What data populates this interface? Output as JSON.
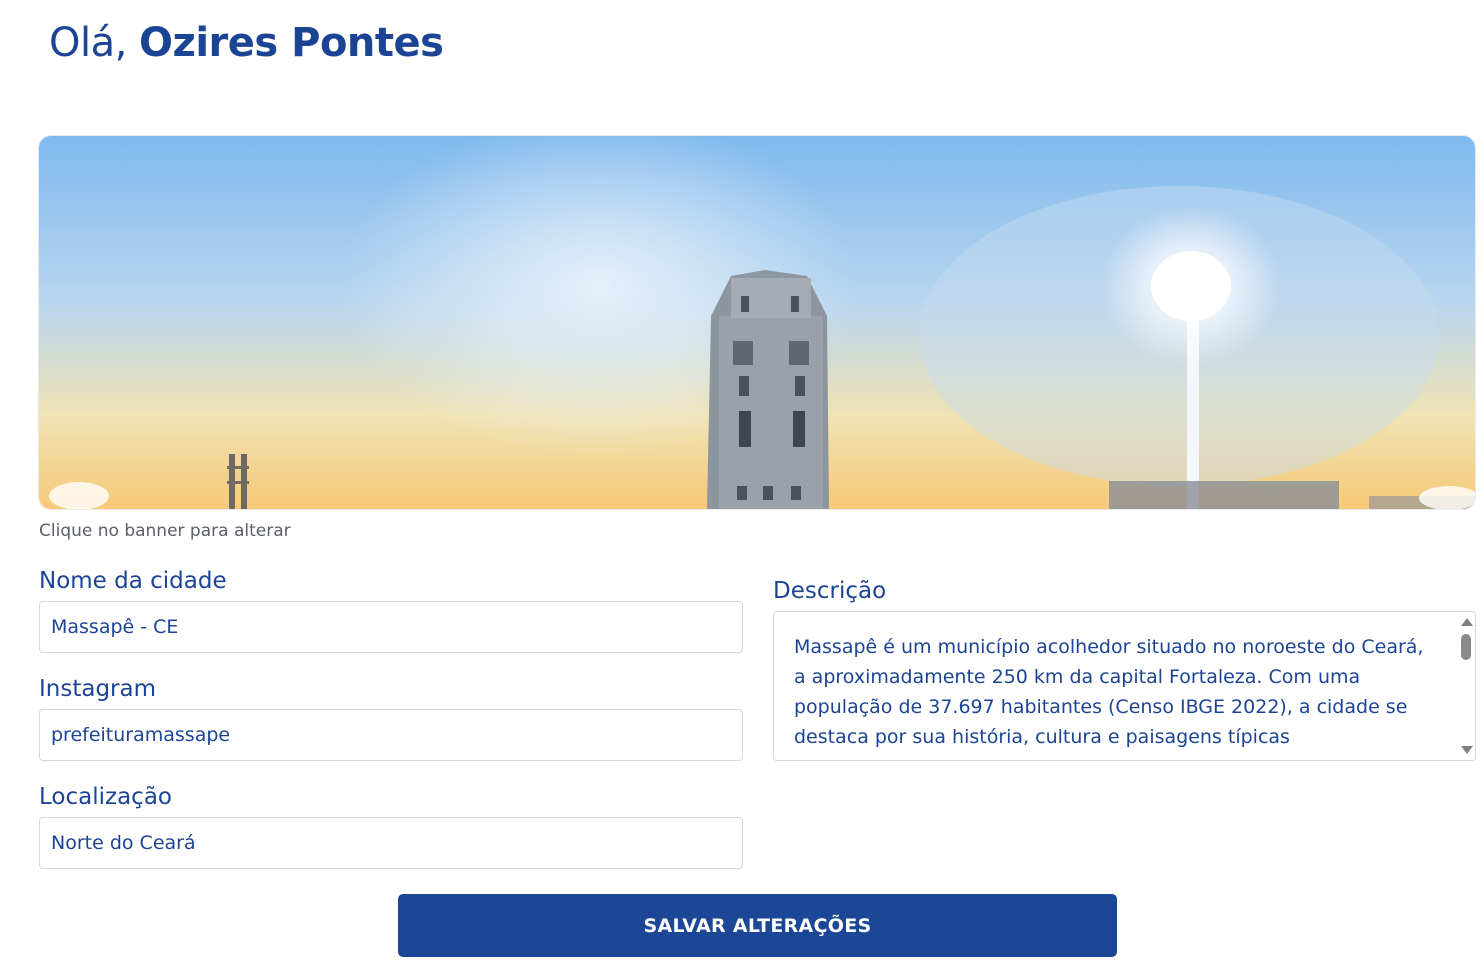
{
  "header": {
    "greeting": "Olá,",
    "user_name": "Ozires Pontes"
  },
  "banner": {
    "image": "city-banner-tower-sky",
    "hint": "Clique no banner para alterar"
  },
  "form": {
    "city_name": {
      "label": "Nome da cidade",
      "value": "Massapê - CE"
    },
    "instagram": {
      "label": "Instagram",
      "value": "prefeituramassape"
    },
    "location": {
      "label": "Localização",
      "value": "Norte do Ceará"
    },
    "description": {
      "label": "Descrição",
      "value": "Massapê é um município acolhedor situado no noroeste do Ceará, a aproximadamente 250 km da capital Fortaleza. Com uma população de 37.697 habitantes (Censo IBGE 2022), a cidade se destaca por sua história, cultura e paisagens típicas"
    },
    "save_label": "SALVAR ALTERAÇÕES"
  },
  "colors": {
    "primary": "#1c4494",
    "button": "#1b4796",
    "border": "#d3d7df",
    "hint_text": "#5a5f6a"
  }
}
